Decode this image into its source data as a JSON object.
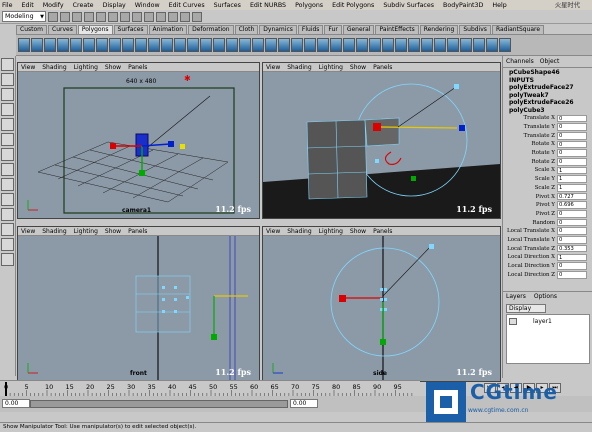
{
  "menubar": {
    "items": [
      "File",
      "Edit",
      "Modify",
      "Create",
      "Display",
      "Window",
      "Edit Curves",
      "Surfaces",
      "Edit NURBS",
      "Polygons",
      "Edit Polygons",
      "Subdiv Surfaces",
      "BodyPaint3D",
      "Help"
    ],
    "watermark": "火星时代"
  },
  "statusline": {
    "mode": "Modeling"
  },
  "shelf": {
    "tabs": [
      "Custom",
      "Curves",
      "Polygons",
      "Surfaces",
      "Animation",
      "Deformation",
      "Cloth",
      "Dynamics",
      "Fluids",
      "Fur",
      "General",
      "PaintEffects",
      "Rendering",
      "Subdivs",
      "RadiantSquare"
    ],
    "active_tab": "Polygons"
  },
  "viewport_menu": [
    "View",
    "Shading",
    "Lighting",
    "Show",
    "Panels"
  ],
  "viewports": {
    "perspective": {
      "resolution": "640 x 480",
      "fps": "11.2 fps",
      "label": "camera1"
    },
    "camera": {
      "fps": "11.2 fps"
    },
    "front": {
      "fps": "11.2 fps",
      "label": "front"
    },
    "side": {
      "fps": "11.2 fps",
      "label": "side"
    }
  },
  "channels": {
    "tabs": [
      "Channels",
      "Object"
    ],
    "object_name": "pCubeShape46",
    "inputs_header": "INPUTS",
    "inputs": [
      "polyExtrudeFace27",
      "polyTweak7",
      "polyExtrudeFace26",
      "polyCube3"
    ],
    "attributes": [
      {
        "label": "Translate X",
        "value": "0"
      },
      {
        "label": "Translate Y",
        "value": "0"
      },
      {
        "label": "Translate Z",
        "value": "0"
      },
      {
        "label": "Rotate X",
        "value": "0"
      },
      {
        "label": "Rotate Y",
        "value": "0"
      },
      {
        "label": "Rotate Z",
        "value": "0"
      },
      {
        "label": "Scale X",
        "value": "1"
      },
      {
        "label": "Scale Y",
        "value": "1"
      },
      {
        "label": "Scale Z",
        "value": "1"
      },
      {
        "label": "Pivot X",
        "value": "0.727"
      },
      {
        "label": "Pivot Y",
        "value": "0.696"
      },
      {
        "label": "Pivot Z",
        "value": "0"
      },
      {
        "label": "Random",
        "value": "0"
      },
      {
        "label": "Local Translate X",
        "value": "0"
      },
      {
        "label": "Local Translate Y",
        "value": "0"
      },
      {
        "label": "Local Translate Z",
        "value": "0.353"
      },
      {
        "label": "Local Direction X",
        "value": "1"
      },
      {
        "label": "Local Direction Y",
        "value": "0"
      },
      {
        "label": "Local Direction Z",
        "value": "0"
      }
    ]
  },
  "layers": {
    "tabs": [
      "Layers",
      "Options"
    ],
    "display": "Display",
    "layer_name": "layer1"
  },
  "timeline": {
    "ticks": [
      "0",
      "5",
      "10",
      "15",
      "20",
      "25",
      "30",
      "35",
      "40",
      "45",
      "50",
      "55",
      "60",
      "65",
      "70",
      "75",
      "80",
      "85",
      "90",
      "95"
    ],
    "range_start": "0.00",
    "range_current": "0.00"
  },
  "helpline": "Show Manipulator Tool: Use manipulator(s) to edit selected object(s).",
  "logo": {
    "text": "CGtime",
    "sub": "www.cgtime.com.cn"
  }
}
